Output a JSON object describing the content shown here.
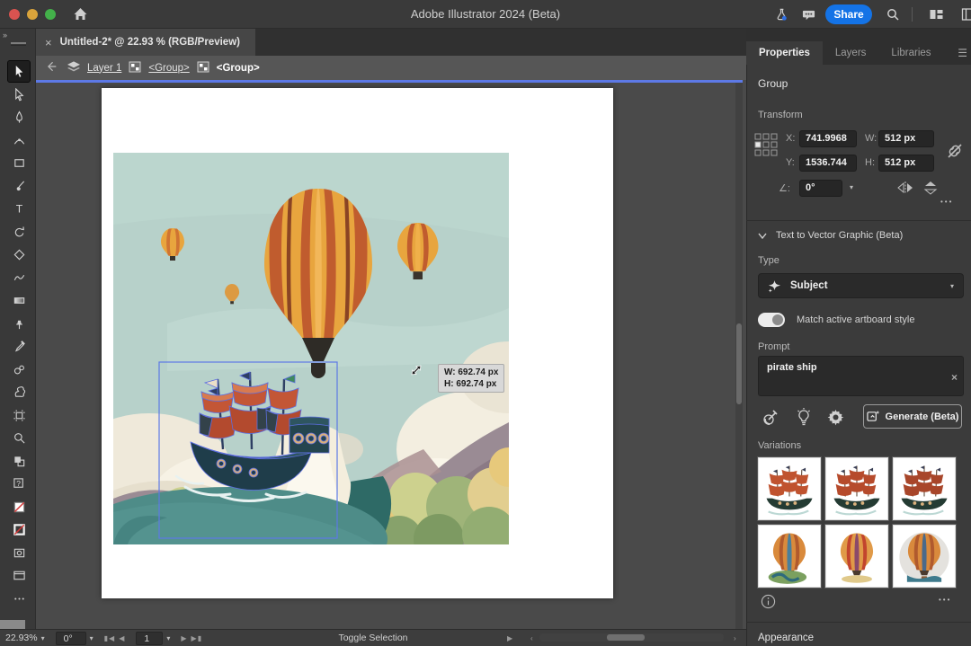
{
  "window": {
    "title": "Adobe Illustrator 2024 (Beta)"
  },
  "titlebar": {
    "share_label": "Share",
    "accent_color": "#1473e6"
  },
  "doc_tab": {
    "close_glyph": "×",
    "label": "Untitled-2* @ 22.93 % (RGB/Preview)"
  },
  "breadcrumb": {
    "items": [
      {
        "label": "Layer 1",
        "icon": "layers-icon",
        "current": false
      },
      {
        "label": "<Group>",
        "icon": "group-icon",
        "current": false
      },
      {
        "label": "<Group>",
        "icon": "group-icon",
        "current": true
      }
    ]
  },
  "toolbar": {
    "expand_glyph": "»",
    "tools": [
      {
        "name": "selection-tool",
        "active": true
      },
      {
        "name": "direct-selection-tool",
        "active": false
      },
      {
        "name": "pen-tool",
        "active": false
      },
      {
        "name": "curvature-tool",
        "active": false
      },
      {
        "name": "rectangle-tool",
        "active": false
      },
      {
        "name": "paintbrush-tool",
        "active": false
      },
      {
        "name": "type-tool",
        "active": false
      },
      {
        "name": "rotate-tool",
        "active": false
      },
      {
        "name": "eraser-tool",
        "active": false
      },
      {
        "name": "shaper-tool",
        "active": false
      },
      {
        "name": "gradient-tool",
        "active": false
      },
      {
        "name": "pin-tool",
        "active": false
      },
      {
        "name": "eyedropper-tool",
        "active": false
      },
      {
        "name": "blend-tool",
        "active": false
      },
      {
        "name": "symbol-sprayer-tool",
        "active": false
      },
      {
        "name": "artboard-tool",
        "active": false
      },
      {
        "name": "zoom-tool",
        "active": false
      },
      {
        "name": "swatch-toggle-icon",
        "active": false
      },
      {
        "name": "help-swatch",
        "active": false
      },
      {
        "name": "fill-swatch",
        "active": false
      },
      {
        "name": "stroke-swatch",
        "active": false
      },
      {
        "name": "draw-mode-toggle",
        "active": false
      },
      {
        "name": "screen-mode-toggle",
        "active": false
      },
      {
        "name": "toolbar-more-button",
        "active": false
      }
    ]
  },
  "canvas": {
    "tooltip": {
      "w_line": "W: 692.74 px",
      "h_line": "H: 692.74 px"
    },
    "selection_color": "#5d79e6"
  },
  "panel": {
    "tabs": [
      {
        "label": "Properties",
        "active": true
      },
      {
        "label": "Layers",
        "active": false
      },
      {
        "label": "Libraries",
        "active": false
      }
    ],
    "group_header": "Group",
    "transform": {
      "title": "Transform",
      "x_label": "X:",
      "x_value": "741.9968",
      "y_label": "Y:",
      "y_value": "1536.744",
      "w_label": "W:",
      "w_value": "512 px",
      "h_label": "H:",
      "h_value": "512 px",
      "angle_label": "∠:",
      "angle_value": "0°",
      "more_glyph": "•••"
    },
    "t2v": {
      "title": "Text to Vector Graphic (Beta)",
      "type_label": "Type",
      "type_value": "Subject",
      "toggle_label": "Match active artboard style",
      "toggle_on": true,
      "prompt_label": "Prompt",
      "prompt_value": "pirate ship",
      "clear_glyph": "×",
      "generate_label": "Generate (Beta)",
      "variations_label": "Variations",
      "variations": [
        {
          "kind": "pirate-ship",
          "variant": 0
        },
        {
          "kind": "pirate-ship",
          "variant": 1
        },
        {
          "kind": "pirate-ship",
          "variant": 2
        },
        {
          "kind": "hot-air-balloon",
          "variant": 0
        },
        {
          "kind": "hot-air-balloon",
          "variant": 1
        },
        {
          "kind": "hot-air-balloon",
          "variant": 2
        }
      ],
      "more_glyph": "•••"
    },
    "appearance_label": "Appearance"
  },
  "statusbar": {
    "zoom": "22.93%",
    "rotation": "0°",
    "page": "1",
    "toggle_label": "Toggle Selection"
  }
}
